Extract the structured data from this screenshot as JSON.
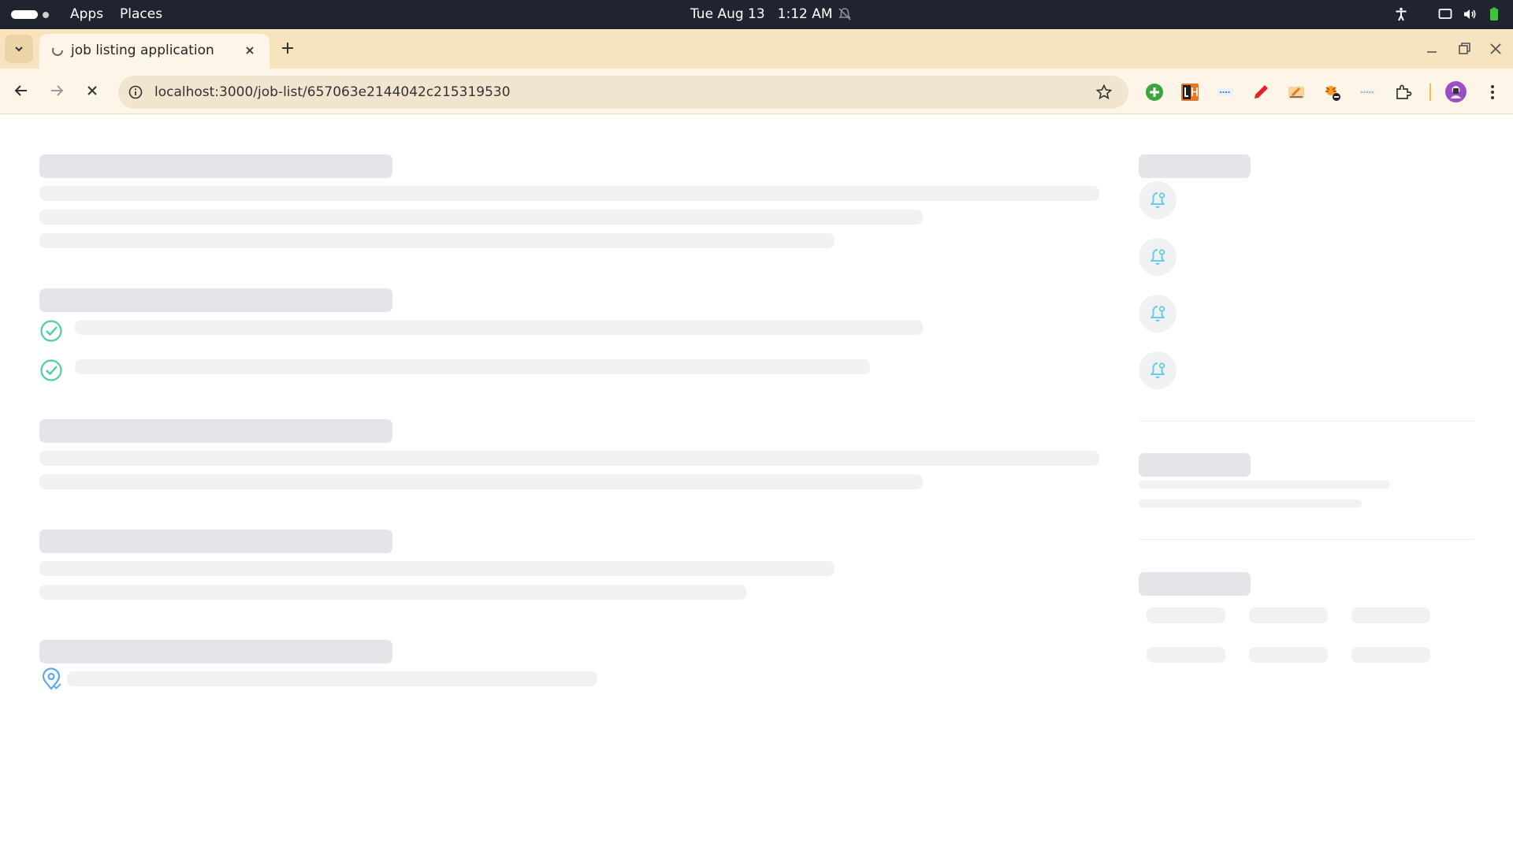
{
  "system_bar": {
    "apps_label": "Apps",
    "places_label": "Places",
    "date": "Tue Aug 13",
    "time": "1:12 AM"
  },
  "browser": {
    "tab": {
      "title": "job listing application"
    },
    "address_bar": {
      "url": "localhost:3000/job-list/657063e2144042c215319530"
    },
    "extensions": [
      "add-extension-icon",
      "lh-extension-icon",
      "extension-icon-3",
      "pen-extension-icon",
      "edit-extension-icon",
      "bug-extension-icon",
      "extension-icon-7",
      "puzzle-extensions-icon"
    ]
  },
  "page": {
    "state": "loading-skeleton",
    "accent_colors": {
      "check": "#4fcfa0",
      "bell": "#56c9e6",
      "location": "#5aa8f0"
    }
  }
}
